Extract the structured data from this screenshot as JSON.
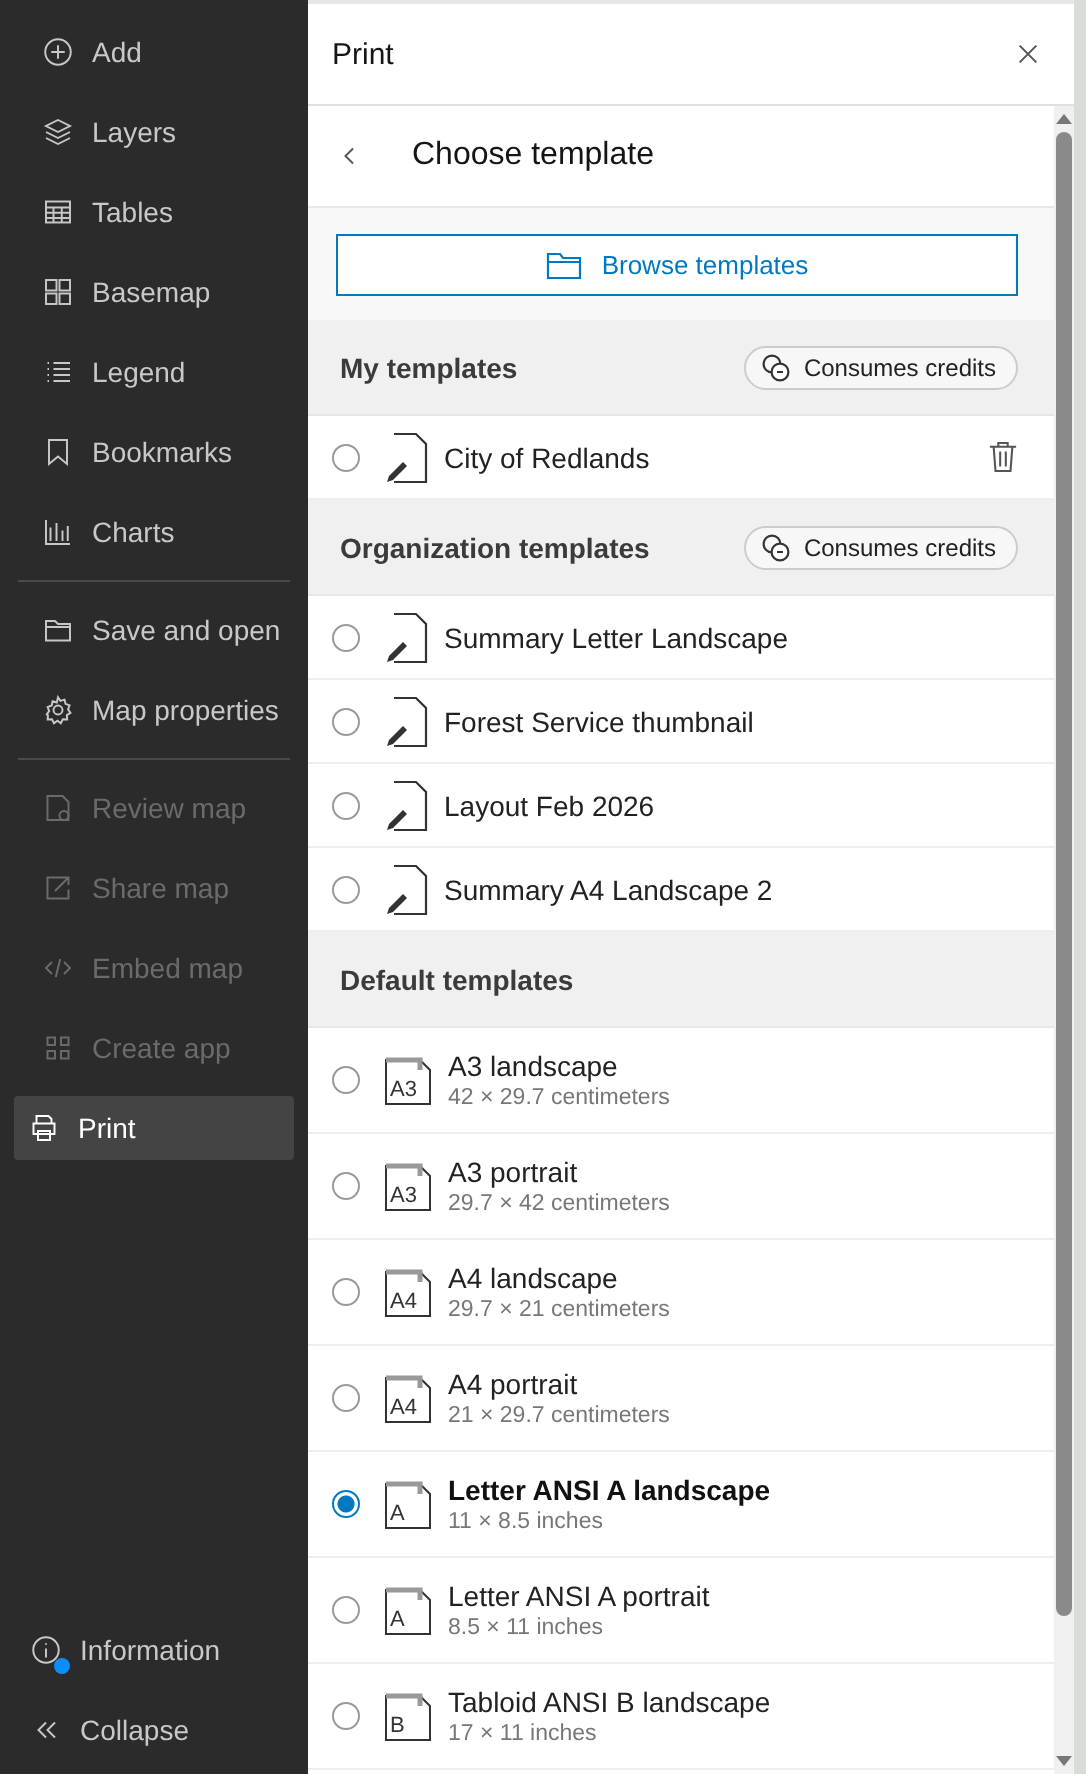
{
  "sidebar": {
    "groups": [
      [
        {
          "label": "Add",
          "disabled": false,
          "selected": false
        },
        {
          "label": "Layers",
          "disabled": false,
          "selected": false
        },
        {
          "label": "Tables",
          "disabled": false,
          "selected": false
        },
        {
          "label": "Basemap",
          "disabled": false,
          "selected": false
        },
        {
          "label": "Legend",
          "disabled": false,
          "selected": false
        },
        {
          "label": "Bookmarks",
          "disabled": false,
          "selected": false
        },
        {
          "label": "Charts",
          "disabled": false,
          "selected": false
        }
      ],
      [
        {
          "label": "Save and open",
          "disabled": false,
          "selected": false
        },
        {
          "label": "Map properties",
          "disabled": false,
          "selected": false
        }
      ],
      [
        {
          "label": "Review map",
          "disabled": true,
          "selected": false
        },
        {
          "label": "Share map",
          "disabled": true,
          "selected": false
        },
        {
          "label": "Embed map",
          "disabled": true,
          "selected": false
        },
        {
          "label": "Create app",
          "disabled": true,
          "selected": false
        },
        {
          "label": "Print",
          "disabled": false,
          "selected": true
        }
      ]
    ],
    "footer": [
      {
        "label": "Information",
        "notification": true
      },
      {
        "label": "Collapse",
        "notification": false
      }
    ]
  },
  "panel": {
    "title": "Print",
    "subheader": "Choose template",
    "browse_button": "Browse templates",
    "sections": [
      {
        "title": "My templates",
        "badge": "Consumes credits",
        "templates": [
          {
            "kind": "custom",
            "name": "City of Redlands",
            "selected": false,
            "deletable": true
          }
        ]
      },
      {
        "title": "Organization templates",
        "badge": "Consumes credits",
        "templates": [
          {
            "kind": "custom",
            "name": "Summary Letter Landscape",
            "selected": false,
            "deletable": false
          },
          {
            "kind": "custom",
            "name": "Forest Service thumbnail",
            "selected": false,
            "deletable": false
          },
          {
            "kind": "custom",
            "name": "Layout Feb 2026",
            "selected": false,
            "deletable": false
          },
          {
            "kind": "custom",
            "name": "Summary A4 Landscape 2",
            "selected": false,
            "deletable": false
          }
        ]
      },
      {
        "title": "Default templates",
        "templates": [
          {
            "kind": "size",
            "name": "A3 landscape",
            "size_label": "A3",
            "dimensions": "42 × 29.7 centimeters",
            "selected": false
          },
          {
            "kind": "size",
            "name": "A3 portrait",
            "size_label": "A3",
            "dimensions": "29.7 × 42 centimeters",
            "selected": false
          },
          {
            "kind": "size",
            "name": "A4 landscape",
            "size_label": "A4",
            "dimensions": "29.7 × 21 centimeters",
            "selected": false
          },
          {
            "kind": "size",
            "name": "A4 portrait",
            "size_label": "A4",
            "dimensions": "21 × 29.7 centimeters",
            "selected": false
          },
          {
            "kind": "size",
            "name": "Letter ANSI A landscape",
            "size_label": "A",
            "dimensions": "11 × 8.5 inches",
            "selected": true
          },
          {
            "kind": "size",
            "name": "Letter ANSI A portrait",
            "size_label": "A",
            "dimensions": "8.5 × 11 inches",
            "selected": false
          },
          {
            "kind": "size",
            "name": "Tabloid ANSI B landscape",
            "size_label": "B",
            "dimensions": "17 × 11 inches",
            "selected": false
          }
        ]
      }
    ]
  }
}
